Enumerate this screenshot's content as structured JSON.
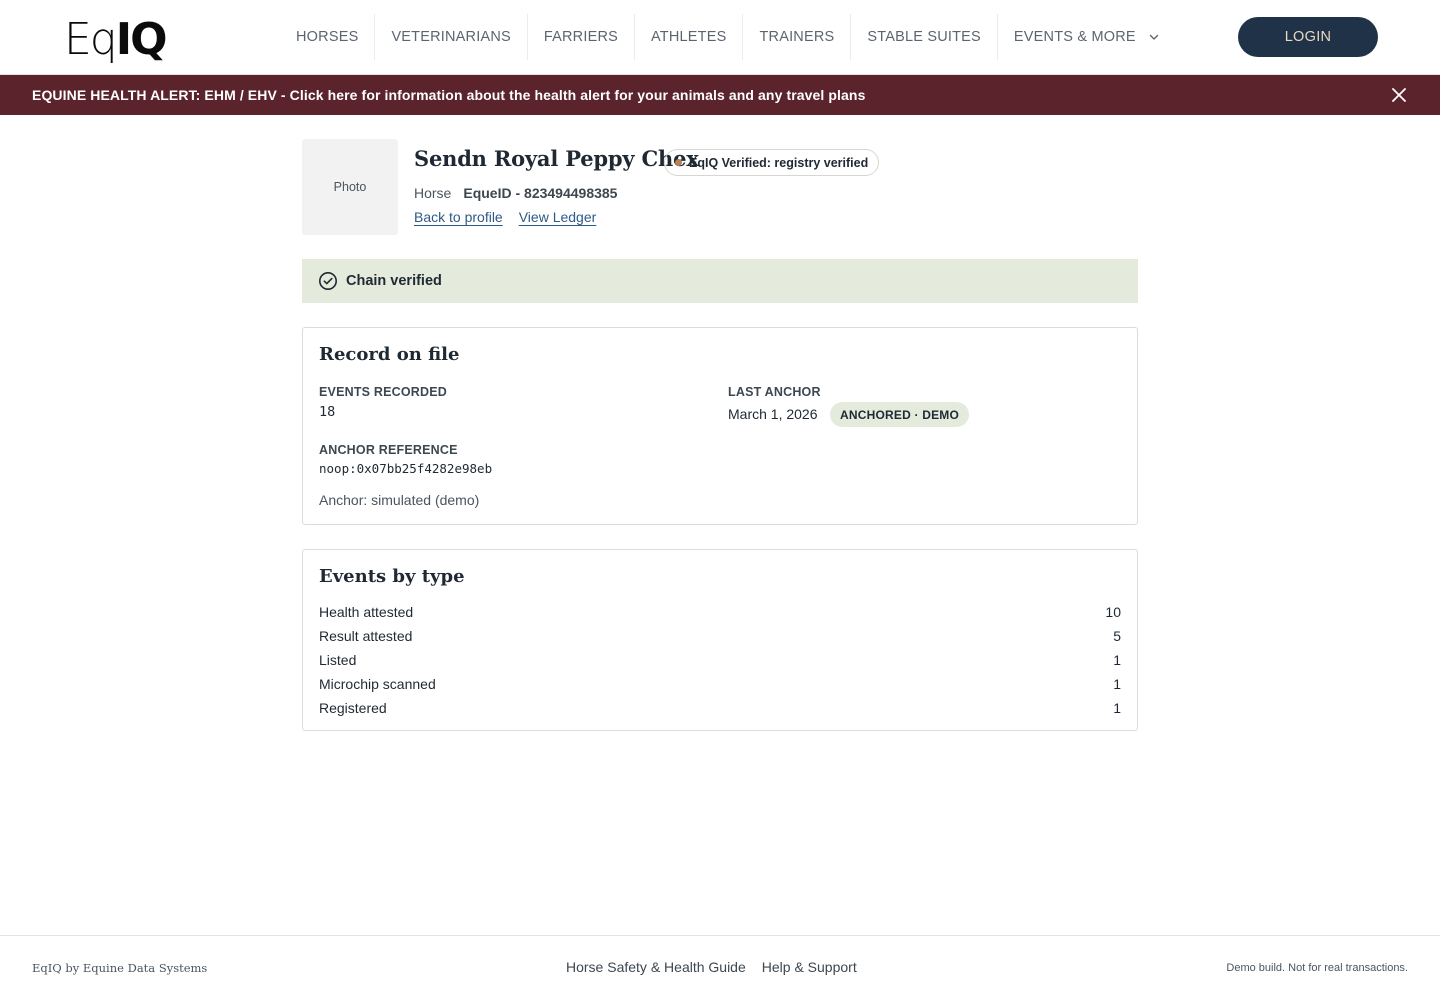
{
  "header": {
    "logo_light": "Eq",
    "logo_bold": "IQ",
    "nav": [
      "HORSES",
      "VETERINARIANS",
      "FARRIERS",
      "ATHLETES",
      "TRAINERS",
      "STABLE SUITES"
    ],
    "nav_dropdown": "EVENTS & MORE",
    "login_label": "LOGIN"
  },
  "alert": {
    "text": "EQUINE HEALTH ALERT: EHM / EHV - Click here for information about the health alert for your animals and any travel plans",
    "close_icon": "close-icon"
  },
  "profile": {
    "photo_label": "Photo",
    "name": "Sendn Royal Peppy Chex",
    "verified_chip": "EqIQ Verified: registry verified",
    "type": "Horse",
    "equeid": "EqueID - 823494498385",
    "links": {
      "back": "Back to profile",
      "ledger": "View Ledger"
    }
  },
  "chain": {
    "label": "Chain verified",
    "icon": "check-circle-icon"
  },
  "record": {
    "title": "Record on file",
    "events_label": "EVENTS RECORDED",
    "events_value": "18",
    "last_anchor_label": "LAST ANCHOR",
    "last_anchor_value": "March 1, 2026",
    "anchor_badge": "ANCHORED · DEMO",
    "anchor_ref_label": "ANCHOR REFERENCE",
    "anchor_ref_value": "noop:0x07bb25f4282e98eb",
    "anchor_note": "Anchor: simulated (demo)"
  },
  "events": {
    "title": "Events by type",
    "rows": [
      {
        "label": "Health attested",
        "count": "10"
      },
      {
        "label": "Result attested",
        "count": "5"
      },
      {
        "label": "Listed",
        "count": "1"
      },
      {
        "label": "Microchip scanned",
        "count": "1"
      },
      {
        "label": "Registered",
        "count": "1"
      }
    ]
  },
  "footer": {
    "left": "EqIQ by Equine Data Systems",
    "links": [
      "Horse Safety & Health Guide",
      "Help & Support"
    ],
    "right": "Demo build. Not for real transactions."
  },
  "colors": {
    "alert_bg": "#5b232b",
    "login_bg": "#1f3247",
    "chain_bg": "#e4eadc",
    "link": "#2e5a86",
    "chip_dot": "#b5805a"
  }
}
